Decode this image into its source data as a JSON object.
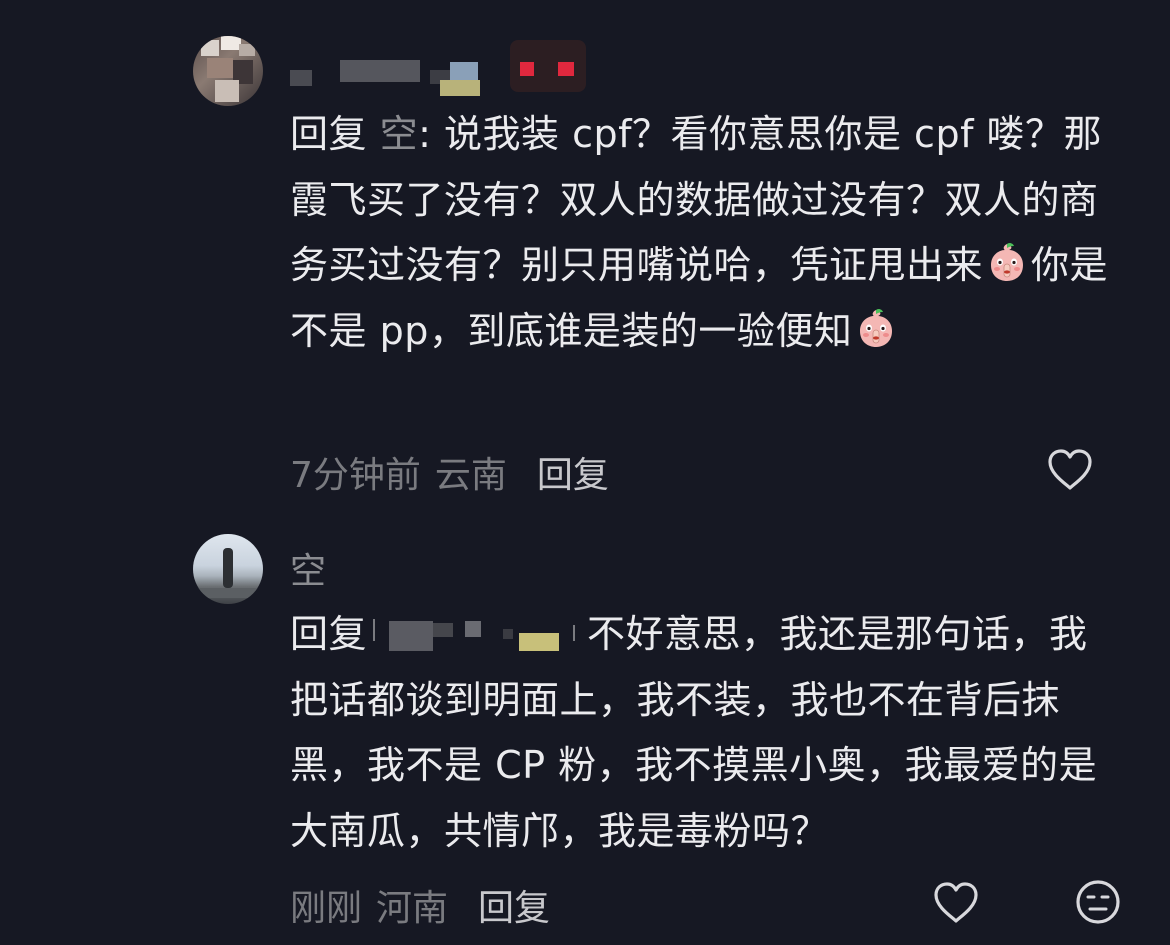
{
  "comments": [
    {
      "username": "",
      "reply_prefix": "回复",
      "mention": "空",
      "text_part1": ": 说我装 cpf？看你意思你是 cpf 喽？那霞飞买了没有？双人的数据做过没有？双人的商务买过没有？别只用嘴说哈，凭证甩出来",
      "text_part2": "你是不是 pp，到底谁是装的一验便知",
      "emoji_name": "shush-peach-emoji",
      "time": "7分钟前",
      "location": "云南",
      "reply_label": "回复"
    },
    {
      "username": "空",
      "reply_prefix": "回复",
      "text_part1": "不好意思，我还是那句话，我把话都谈到明面上，我不装，我也不在背后抹黑，我不是 CP 粉，我不摸黑小奥，我最爱的是大南瓜，共情邝，我是毒粉吗？",
      "time": "刚刚",
      "location": "河南",
      "reply_label": "回复"
    }
  ],
  "icons": {
    "like": "heart-outline-icon",
    "dislike": "neutral-face-icon"
  },
  "colors": {
    "background": "#161823",
    "text": "#ebebee",
    "muted": "#7a7b80",
    "username": "#8b8c91"
  }
}
